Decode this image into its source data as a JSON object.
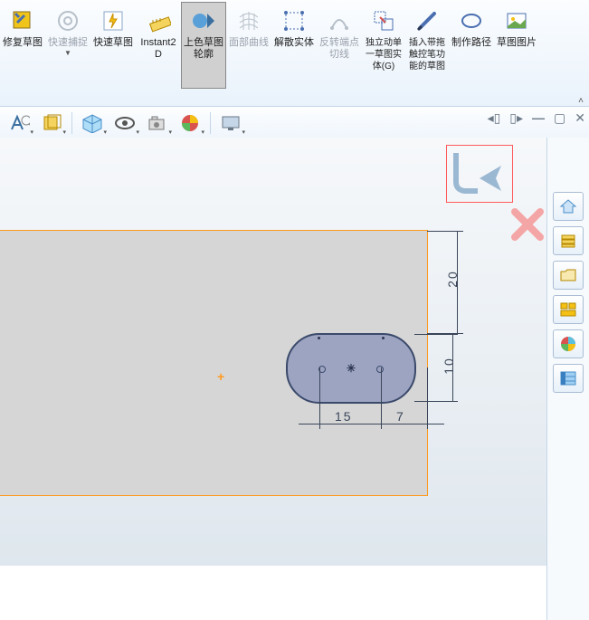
{
  "ribbon": {
    "items": [
      {
        "label": "修复草图",
        "enabled": true
      },
      {
        "label": "快速捕捉",
        "enabled": false
      },
      {
        "label": "快速草图",
        "enabled": true
      },
      {
        "label": "Instant2D",
        "enabled": true
      },
      {
        "label": "上色草图轮廓",
        "enabled": true,
        "selected": true
      },
      {
        "label": "面部曲线",
        "enabled": false
      },
      {
        "label": "解散实体",
        "enabled": true
      },
      {
        "label": "反转端点切线",
        "enabled": false
      },
      {
        "label": "独立动单一草图实体(G)",
        "enabled": true
      },
      {
        "label": "插入带拖触控笔功能的草图",
        "enabled": true
      },
      {
        "label": "制作路径",
        "enabled": true
      },
      {
        "label": "草图图片",
        "enabled": true
      }
    ]
  },
  "dimensions": {
    "top": "20",
    "right": "10",
    "bottom_left": "15",
    "bottom_right": "7"
  },
  "toolbar2_names": [
    "sketch-text-icon",
    "box-icon",
    "cube-icon",
    "eye-icon",
    "camera-icon",
    "appearance-icon",
    "display-icon"
  ],
  "side_names": [
    "home-icon",
    "layers-icon",
    "open-icon",
    "tile-icon",
    "colors-icon",
    "list-icon"
  ]
}
